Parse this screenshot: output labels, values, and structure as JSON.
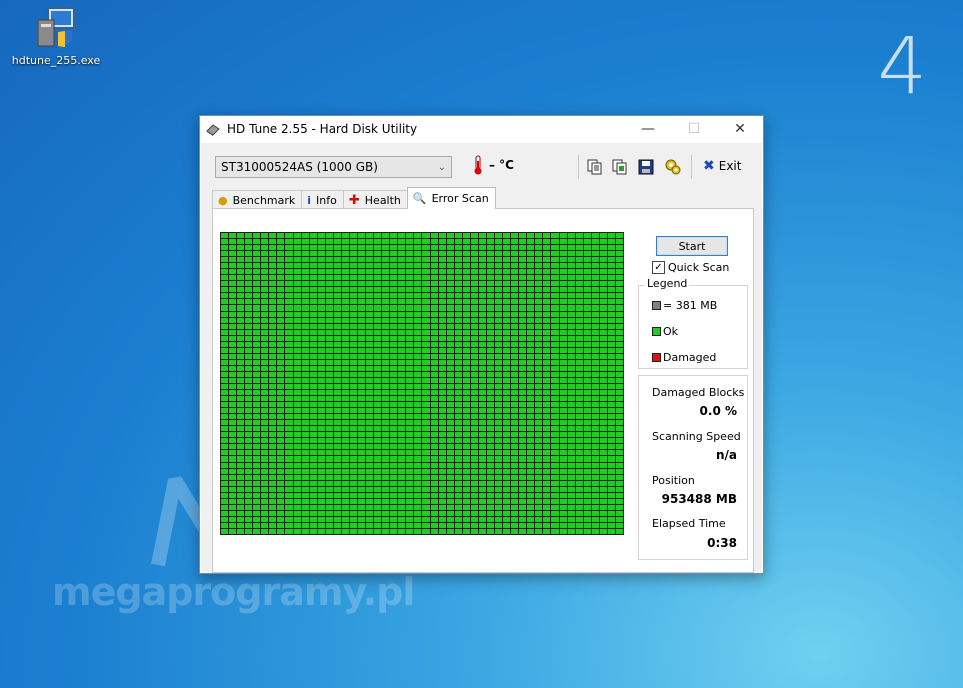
{
  "desktop": {
    "icon_label": "hdtune_255.exe",
    "corner_number": "4",
    "watermark": "megaprogramy.pl"
  },
  "window": {
    "title": "HD Tune 2.55 - Hard Disk Utility",
    "drive": "ST31000524AS (1000 GB)",
    "temperature": "– °C",
    "exit_label": "Exit",
    "tabs": [
      {
        "label": "Benchmark",
        "icon": "benchmark-icon"
      },
      {
        "label": "Info",
        "icon": "info-icon"
      },
      {
        "label": "Health",
        "icon": "health-icon"
      },
      {
        "label": "Error Scan",
        "icon": "magnifier-icon",
        "active": true
      }
    ]
  },
  "scan": {
    "start_label": "Start",
    "quick_scan_label": "Quick Scan",
    "quick_scan_checked": true,
    "legend_title": "Legend",
    "legend": [
      {
        "label": "= 381 MB",
        "color": "#808080"
      },
      {
        "label": "Ok",
        "color": "#1fcf1f"
      },
      {
        "label": "Damaged",
        "color": "#e01010"
      }
    ],
    "stats": {
      "damaged_blocks_label": "Damaged Blocks",
      "damaged_blocks_value": "0.0 %",
      "scanning_speed_label": "Scanning Speed",
      "scanning_speed_value": "n/a",
      "position_label": "Position",
      "position_value": "953488 MB",
      "elapsed_label": "Elapsed Time",
      "elapsed_value": "0:38"
    },
    "block_color_ok": "#1fcf1f"
  }
}
